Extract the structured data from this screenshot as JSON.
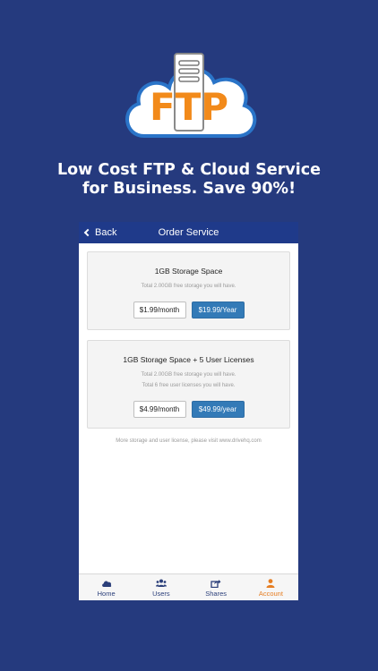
{
  "logo": {
    "text": "FTP",
    "icon": "cloud-server-icon"
  },
  "headline": {
    "line1": "Low Cost FTP & Cloud Service",
    "line2": "for Business. Save 90%!"
  },
  "navbar": {
    "back_label": "Back",
    "title": "Order Service"
  },
  "plans": [
    {
      "title": "1GB Storage Space",
      "notes": [
        "Total 2.00GB free storage you will have."
      ],
      "monthly_label": "$1.99/month",
      "yearly_label": "$19.99/Year"
    },
    {
      "title": "1GB Storage Space + 5 User Licenses",
      "notes": [
        "Total 2.00GB free storage you will have.",
        "Total 6 free user licenses you will have."
      ],
      "monthly_label": "$4.99/month",
      "yearly_label": "$49.99/year"
    }
  ],
  "footer_note": "More storage and user license, please visit www.drivehq.com",
  "tabs": [
    {
      "label": "Home",
      "icon": "cloud-icon",
      "active": false
    },
    {
      "label": "Users",
      "icon": "users-icon",
      "active": false
    },
    {
      "label": "Shares",
      "icon": "share-icon",
      "active": false
    },
    {
      "label": "Account",
      "icon": "person-icon",
      "active": true
    }
  ],
  "colors": {
    "background": "#253a7e",
    "navbar": "#1f3a8a",
    "primary_button": "#337ab7",
    "logo_orange": "#f28a1a",
    "active_tab": "#e67e22"
  }
}
